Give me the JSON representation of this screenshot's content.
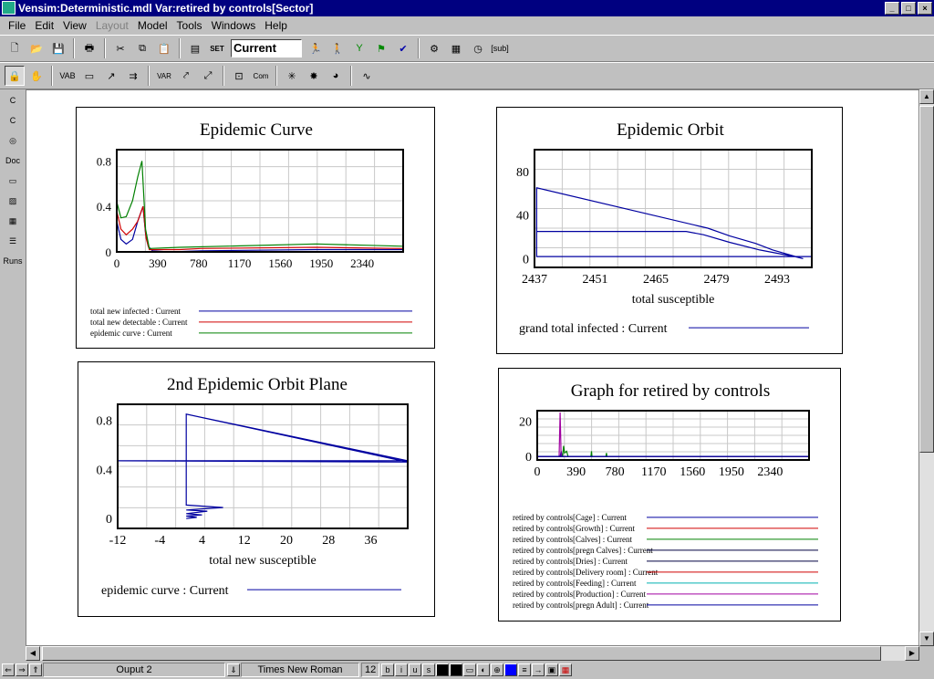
{
  "window": {
    "title": "Vensim:Deterministic.mdl Var:retired by controls[Sector]",
    "minimize": "_",
    "maximize": "□",
    "close": "×"
  },
  "menu": [
    "File",
    "Edit",
    "View",
    "Layout",
    "Model",
    "Tools",
    "Windows",
    "Help"
  ],
  "toolbar": {
    "run_name": "Current",
    "set_label": "SET",
    "sub_label": "[sub]"
  },
  "toolbar2": {
    "var_label": "VAR",
    "com_label": "Com"
  },
  "sidebar": [
    "C",
    "C",
    "◎",
    "Doc",
    "▭",
    "▨",
    "▦",
    "☰",
    "Runs"
  ],
  "status": {
    "view": "Ouput 2",
    "font": "Times New Roman",
    "size": "12",
    "b": "b",
    "i": "i",
    "u": "u",
    "s": "s"
  },
  "colors": {
    "blue": "#0000a0",
    "red": "#d00000",
    "green": "#008000",
    "cyan": "#00b0b0",
    "purple": "#a000a0",
    "dark": "#000040"
  },
  "charts": [
    {
      "id": "epidemic-curve",
      "chart_data": {
        "type": "line",
        "title": "Epidemic Curve",
        "xlabel": "",
        "xlim": [
          0,
          2730
        ],
        "ylim": [
          0,
          0.9
        ],
        "xticks": [
          "0",
          "390",
          "780",
          "1170",
          "1560",
          "1950",
          "2340"
        ],
        "yticks": [
          "0",
          "0.4",
          "0.8"
        ],
        "grid": true,
        "series": [
          {
            "name": "total new infected : Current",
            "color": "#0000a0",
            "points": [
              [
                0,
                0.27
              ],
              [
                40,
                0.11
              ],
              [
                90,
                0.07
              ],
              [
                150,
                0.11
              ],
              [
                200,
                0.27
              ],
              [
                250,
                0.4
              ],
              [
                275,
                0.16
              ],
              [
                300,
                0.05
              ],
              [
                340,
                0.01
              ],
              [
                500,
                0
              ],
              [
                800,
                0.01
              ],
              [
                1900,
                0.02
              ],
              [
                2730,
                0.02
              ]
            ]
          },
          {
            "name": "total new detectable : Current",
            "color": "#d00000",
            "points": [
              [
                0,
                0.36
              ],
              [
                40,
                0.2
              ],
              [
                90,
                0.15
              ],
              [
                150,
                0.2
              ],
              [
                200,
                0.27
              ],
              [
                250,
                0.4
              ],
              [
                280,
                0.12
              ],
              [
                310,
                0.02
              ],
              [
                600,
                0.02
              ],
              [
                800,
                0.03
              ],
              [
                1900,
                0.04
              ],
              [
                2730,
                0.03
              ]
            ]
          },
          {
            "name": "epidemic curve : Current",
            "color": "#008000",
            "points": [
              [
                0,
                0.44
              ],
              [
                40,
                0.3
              ],
              [
                90,
                0.31
              ],
              [
                150,
                0.45
              ],
              [
                200,
                0.66
              ],
              [
                240,
                0.8
              ],
              [
                275,
                0.2
              ],
              [
                310,
                0.03
              ],
              [
                600,
                0.04
              ],
              [
                1900,
                0.07
              ],
              [
                2730,
                0.05
              ]
            ]
          }
        ]
      }
    },
    {
      "id": "epidemic-orbit",
      "chart_data": {
        "type": "line",
        "title": "Epidemic Orbit",
        "xlabel": "total susceptible",
        "xlim": [
          2437,
          2501
        ],
        "ylim": [
          -8,
          100
        ],
        "xticks": [
          "2437",
          "2451",
          "2465",
          "2479",
          "2493"
        ],
        "yticks": [
          "0",
          "40",
          "80"
        ],
        "grid": true,
        "series": [
          {
            "name": "grand total infected : Current",
            "color": "#0000a0",
            "points": [
              [
                2437.5,
                8
              ],
              [
                2437.5,
                65
              ],
              [
                2477,
                28
              ],
              [
                2482,
                21
              ],
              [
                2488,
                14
              ],
              [
                2492,
                8
              ],
              [
                2499,
                0
              ],
              [
                2497,
                2
              ],
              [
                2489,
                8
              ],
              [
                2482,
                15
              ],
              [
                2476,
                22
              ],
              [
                2472,
                25
              ],
              [
                2437.5,
                25
              ],
              [
                2437.5,
                2
              ],
              [
                2501,
                2
              ],
              [
                2501,
                14
              ]
            ]
          }
        ]
      }
    },
    {
      "id": "orbit-plane",
      "chart_data": {
        "type": "line",
        "title": "2nd Epidemic Orbit Plane",
        "xlabel": "total new susceptible",
        "xlim": [
          -12,
          43
        ],
        "ylim": [
          -0.08,
          0.93
        ],
        "xticks": [
          "-12",
          "-4",
          "4",
          "12",
          "20",
          "28",
          "36"
        ],
        "yticks": [
          "0",
          "0.4",
          "0.8"
        ],
        "grid": true,
        "series": [
          {
            "name": "epidemic curve : Current",
            "color": "#0000a0",
            "points": [
              [
                1,
                0.85
              ],
              [
                43,
                0.47
              ],
              [
                -12,
                0.47
              ],
              [
                43,
                0.46
              ],
              [
                1,
                0.85
              ],
              [
                1,
                0.11
              ],
              [
                8,
                0.09
              ],
              [
                1,
                0.07
              ],
              [
                5,
                0.06
              ],
              [
                1,
                0.04
              ],
              [
                4,
                0.03
              ],
              [
                1,
                0.02
              ],
              [
                3,
                0.01
              ],
              [
                1,
                0
              ]
            ]
          }
        ]
      }
    },
    {
      "id": "retired-by-controls",
      "chart_data": {
        "type": "line",
        "title": "Graph for retired by controls",
        "xlabel": "",
        "xlim": [
          0,
          2730
        ],
        "ylim": [
          -2,
          26
        ],
        "xticks": [
          "0",
          "390",
          "780",
          "1170",
          "1560",
          "1950",
          "2340"
        ],
        "yticks": [
          "0",
          "20"
        ],
        "grid": true,
        "series": [
          {
            "name": "retired by controls[Cage] : Current",
            "color": "#0000a0",
            "points": [
              [
                0,
                0
              ],
              [
                230,
                0
              ],
              [
                240,
                3
              ],
              [
                250,
                0
              ],
              [
                2730,
                0
              ]
            ]
          },
          {
            "name": "retired by controls[Growth] : Current",
            "color": "#d00000",
            "points": [
              [
                0,
                0
              ],
              [
                2730,
                0
              ]
            ]
          },
          {
            "name": "retired by controls[Calves] : Current",
            "color": "#008000",
            "points": [
              [
                0,
                0
              ],
              [
                255,
                0
              ],
              [
                265,
                6
              ],
              [
                275,
                2
              ],
              [
                295,
                3
              ],
              [
                310,
                0
              ],
              [
                540,
                0
              ],
              [
                545,
                3
              ],
              [
                550,
                0
              ],
              [
                690,
                0
              ],
              [
                695,
                2
              ],
              [
                700,
                0
              ],
              [
                2730,
                0
              ]
            ]
          },
          {
            "name": "retired by controls[pregn Calves] : Current",
            "color": "#000040",
            "points": [
              [
                0,
                0
              ],
              [
                2730,
                0
              ]
            ]
          },
          {
            "name": "retired by controls[Dries] : Current",
            "color": "#000040",
            "points": [
              [
                0,
                0
              ],
              [
                2730,
                0
              ]
            ]
          },
          {
            "name": "retired by controls[Delivery room] : Current",
            "color": "#d00000",
            "points": [
              [
                0,
                0
              ],
              [
                2730,
                0
              ]
            ]
          },
          {
            "name": "retired by controls[Feeding] : Current",
            "color": "#00b0b0",
            "points": [
              [
                0,
                0
              ],
              [
                2730,
                0
              ]
            ]
          },
          {
            "name": "retired by controls[Production] : Current",
            "color": "#a000a0",
            "points": [
              [
                0,
                0
              ],
              [
                220,
                0
              ],
              [
                230,
                25
              ],
              [
                240,
                0
              ],
              [
                2730,
                0
              ]
            ]
          },
          {
            "name": "retired by controls[pregn Adult] : Current",
            "color": "#0000a0",
            "points": [
              [
                0,
                0
              ],
              [
                2730,
                0
              ]
            ]
          }
        ]
      }
    }
  ]
}
